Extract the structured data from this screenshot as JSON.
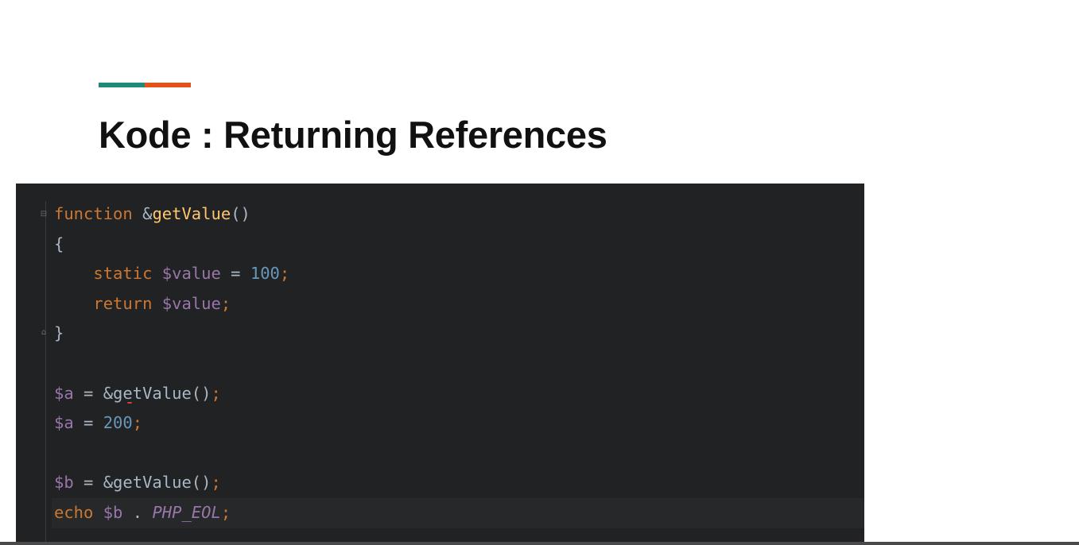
{
  "slide": {
    "title": "Kode : Returning References",
    "accent_colors": [
      "#1e8a7a",
      "#e0541c"
    ]
  },
  "editor": {
    "background": "#212223",
    "colors": {
      "keyword": "#cc7832",
      "function": "#ffc66d",
      "variable": "#9876aa",
      "number": "#6897bb",
      "default": "#a9b7c6",
      "semicolon": "#cc7832",
      "constant": "#9876aa"
    },
    "lines": [
      [
        {
          "t": "function",
          "c": "keyword"
        },
        {
          "t": " &",
          "c": "default"
        },
        {
          "t": "getValue",
          "c": "function"
        },
        {
          "t": "()",
          "c": "default"
        }
      ],
      [
        {
          "t": "{",
          "c": "default"
        }
      ],
      [
        {
          "t": "    static",
          "c": "keyword"
        },
        {
          "t": " $value",
          "c": "variable"
        },
        {
          "t": " = ",
          "c": "default"
        },
        {
          "t": "100",
          "c": "number"
        },
        {
          "t": ";",
          "c": "semicolon"
        }
      ],
      [
        {
          "t": "    return",
          "c": "keyword"
        },
        {
          "t": " $value",
          "c": "variable"
        },
        {
          "t": ";",
          "c": "semicolon"
        }
      ],
      [
        {
          "t": "}",
          "c": "default"
        }
      ],
      [],
      [
        {
          "t": "$a",
          "c": "variable"
        },
        {
          "t": " = &getValue()",
          "c": "default"
        },
        {
          "t": ";",
          "c": "semicolon"
        }
      ],
      [
        {
          "t": "$a",
          "c": "variable"
        },
        {
          "t": " = ",
          "c": "default"
        },
        {
          "t": "200",
          "c": "number"
        },
        {
          "t": ";",
          "c": "semicolon"
        }
      ],
      [],
      [
        {
          "t": "$b",
          "c": "variable"
        },
        {
          "t": " = &getValue()",
          "c": "default"
        },
        {
          "t": ";",
          "c": "semicolon"
        }
      ],
      [
        {
          "t": "echo",
          "c": "keyword"
        },
        {
          "t": " $b",
          "c": "variable"
        },
        {
          "t": " . ",
          "c": "default"
        },
        {
          "t": "PHP_EOL",
          "c": "constant",
          "italic": true
        },
        {
          "t": ";",
          "c": "semicolon"
        }
      ]
    ],
    "current_line_index": 10
  }
}
